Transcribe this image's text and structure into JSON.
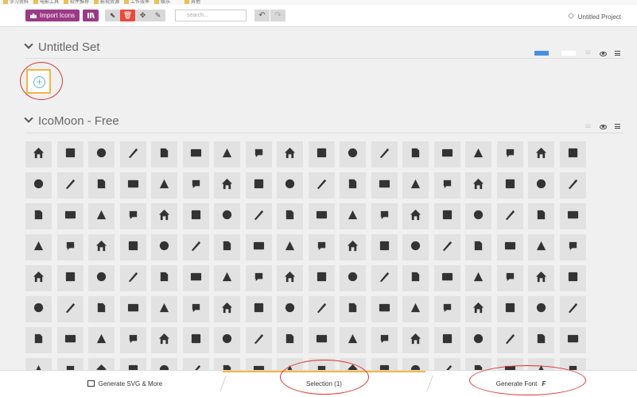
{
  "bookmarks": [
    "学习资料",
    "电影工具",
    "软件推荐",
    "影视资源",
    "工作效率",
    "娱乐",
    "其他"
  ],
  "toolbar": {
    "import_label": "Import Icons",
    "search_placeholder": "search...",
    "project_label": "Untitled Project"
  },
  "sets": [
    {
      "title": "Untitled Set",
      "count": "32"
    },
    {
      "title": "IcoMoon - Free",
      "count": "32"
    }
  ],
  "icons": [
    "home",
    "home2",
    "home3",
    "office",
    "newspaper",
    "pencil",
    "pencil2",
    "quill",
    "pen",
    "blog",
    "eyedropper",
    "droplet",
    "paint-format",
    "image",
    "images",
    "camera",
    "headphones",
    "music",
    "play",
    "film",
    "video-camera",
    "dice",
    "pacman",
    "spades",
    "clubs",
    "diamonds",
    "bullhorn",
    "connection",
    "podcast",
    "feed",
    "mic",
    "book",
    "books",
    "library",
    "file-text",
    "profile",
    "file-empty",
    "files-empty",
    "file-text2",
    "file-picture",
    "file-music",
    "file-play",
    "file-video",
    "file-zip",
    "copy",
    "paste",
    "stack",
    "folder",
    "folder-open",
    "folder-plus",
    "folder-minus",
    "folder-download",
    "folder-upload",
    "price-tag",
    "price-tags",
    "barcode",
    "qrcode",
    "ticket",
    "cart",
    "coin-dollar",
    "coin-euro",
    "coin-pound",
    "coin-yen",
    "credit-card",
    "calculator",
    "lifebuoy",
    "phone",
    "phone-hang-up",
    "address-book",
    "envelop",
    "pushpin",
    "location",
    "location2",
    "compass",
    "compass2",
    "map",
    "map2",
    "history",
    "clock",
    "clock2",
    "alarm",
    "bell",
    "stopwatch",
    "calendar",
    "printer",
    "keyboard",
    "display",
    "laptop",
    "mobile",
    "mobile2",
    "tablet",
    "tv",
    "drawer",
    "drawer2",
    "box-add",
    "box-remove",
    "download",
    "upload",
    "floppy-disk",
    "drive",
    "database",
    "undo",
    "redo",
    "undo2",
    "redo2",
    "forward",
    "reply",
    "bubble",
    "bubbles",
    "bubbles2",
    "bubble2",
    "bubbles3",
    "bubbles4",
    "user",
    "users",
    "user-plus",
    "user-minus",
    "user-check",
    "user-tie",
    "quotes-left",
    "quotes-right",
    "hour-glass",
    "spinner",
    "spinner2",
    "spinner3",
    "spinner4",
    "spinner5",
    "spinner6",
    "spinner7",
    "spinner8",
    "spinner9",
    "spinner10",
    "spinner11",
    "binoculars",
    "search",
    "zoom-in",
    "zoom-out",
    "enlarge",
    "shrink",
    "enlarge2",
    "shrink2",
    "key",
    "key2",
    "lock"
  ],
  "footer": {
    "svg_label": "Generate SVG & More",
    "selection_label": "Selection (1)",
    "font_label": "Generate Font"
  },
  "colors": {
    "brand": "#9b3a86",
    "accent_red": "#e64c3c",
    "selection_yellow": "#f5b342",
    "tile": "#e2e2e2"
  }
}
